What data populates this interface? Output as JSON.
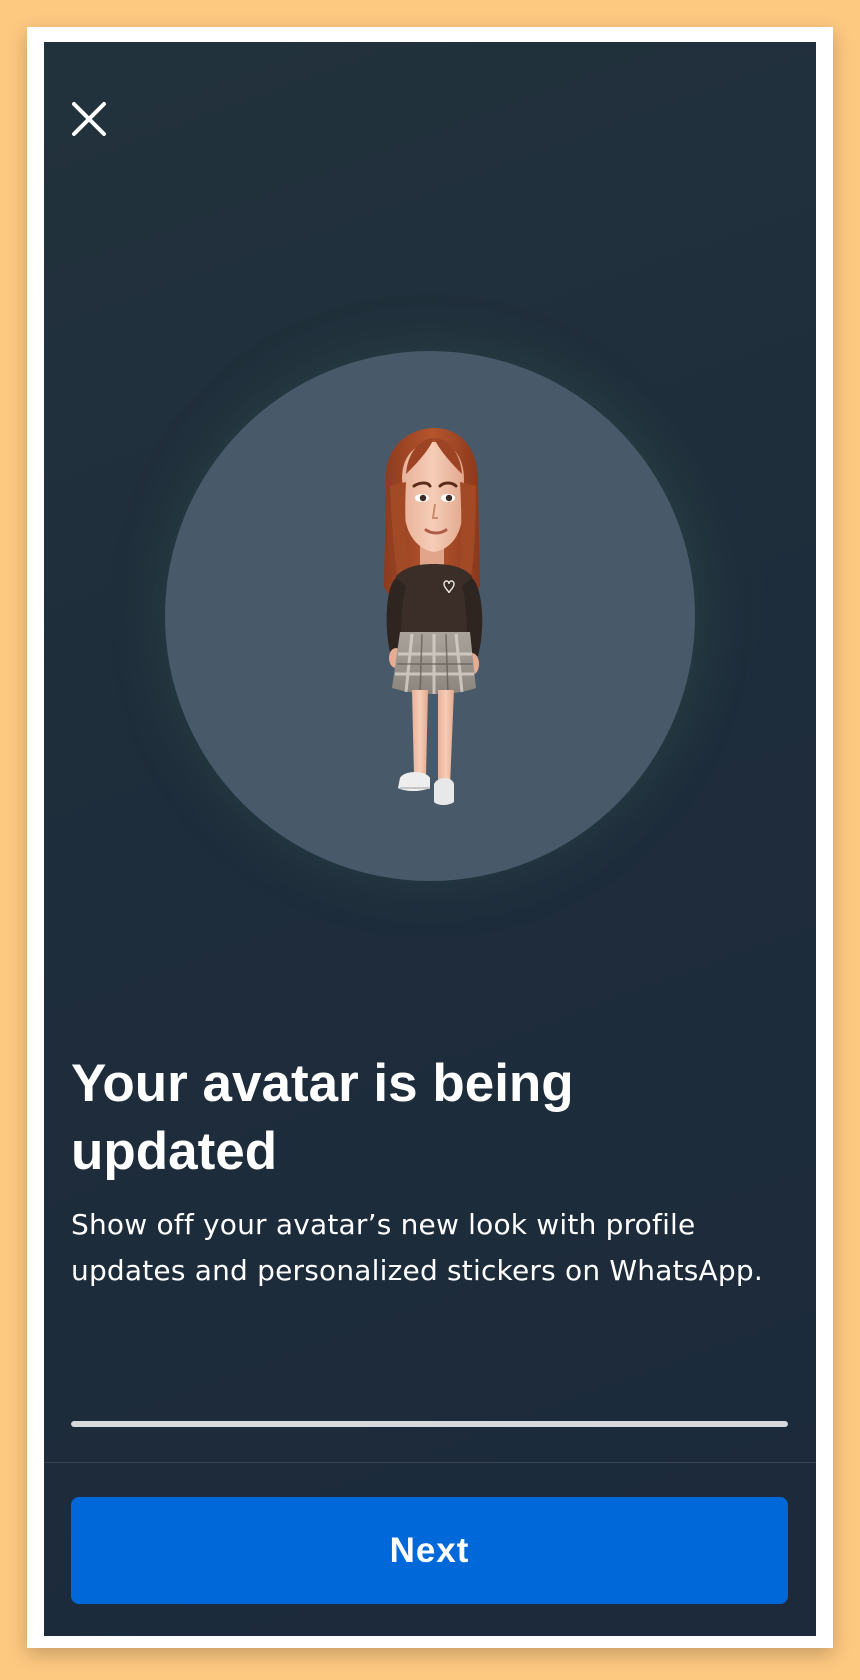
{
  "header": {
    "close_icon": "close-icon"
  },
  "avatar": {
    "image": "3d-avatar-figure"
  },
  "content": {
    "title": "Your avatar is being updated",
    "description": "Show off your avatar’s new look with profile updates and personalized stickers on WhatsApp."
  },
  "progress": {
    "value": 1.0
  },
  "footer": {
    "next_label": "Next"
  },
  "colors": {
    "background": "#1e2d3b",
    "circle": "#485a6a",
    "button": "#0068d9",
    "page_border": "#fdc880"
  }
}
